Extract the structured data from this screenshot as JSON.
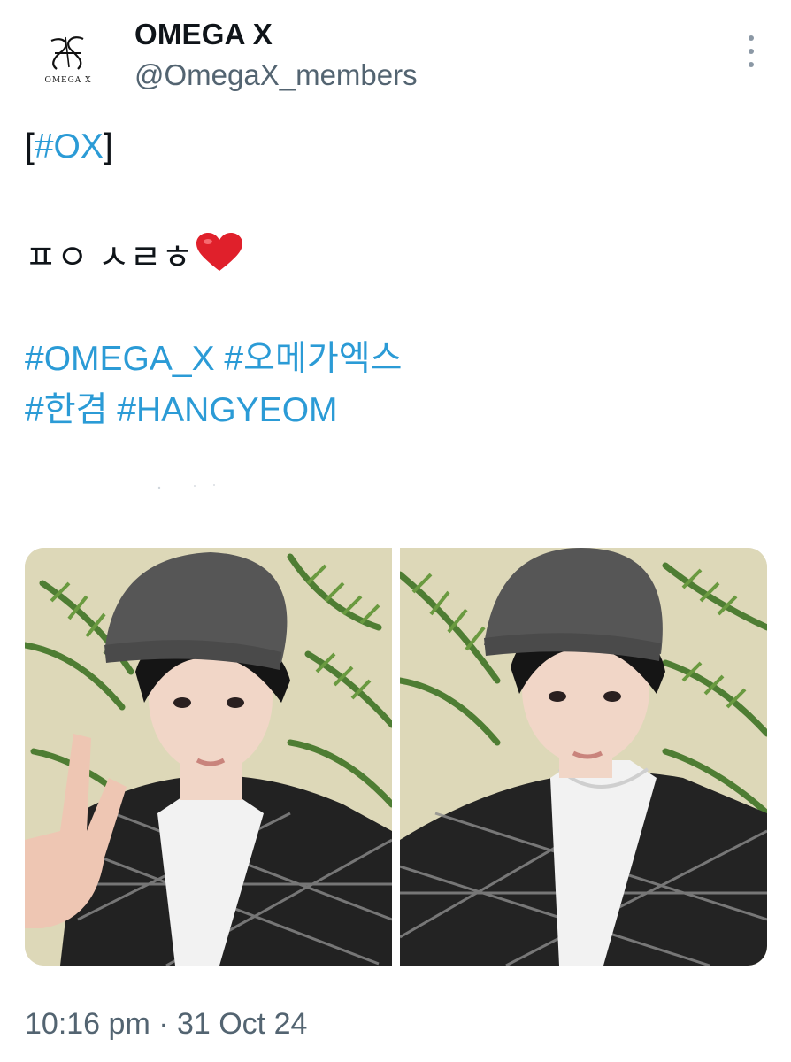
{
  "author": {
    "display_name": "OMEGA X",
    "handle": "@OmegaX_members",
    "avatar_logo_text": "OMEGA X"
  },
  "tweet": {
    "lines": {
      "line1_bracket_open": "[",
      "line1_hashtag": "#OX",
      "line1_bracket_close": "]",
      "line2_text": "ㅍㅇ ㅅㄹㅎ",
      "line2_emoji": "heart-emoji",
      "line3_tag1": "#OMEGA_X",
      "line3_tag2": "#오메가엑스",
      "line4_tag1": "#한겸",
      "line4_tag2": "#HANGYEOM"
    },
    "media_count": 2,
    "timestamp": "10:16 pm · 31 Oct 24"
  },
  "colors": {
    "hashtag": "#2b9bd6",
    "text": "#0f1419",
    "secondary": "#536471",
    "heart": "#e0202b"
  },
  "icons": {
    "more": "more-vertical-icon",
    "heart": "heart-emoji"
  }
}
